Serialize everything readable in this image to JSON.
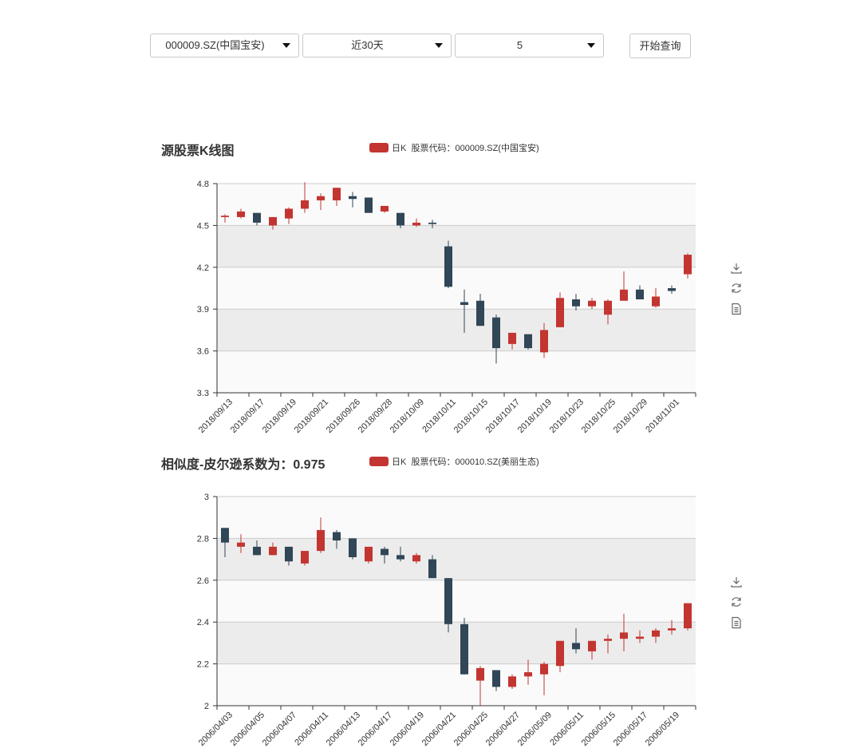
{
  "controls": {
    "stock_select": "000009.SZ(中国宝安)",
    "range_select": "近30天",
    "count_select": "5",
    "query_button": "开始查询"
  },
  "toolbox": [
    "download-icon",
    "refresh-icon",
    "data-view-icon"
  ],
  "colors": {
    "up": "#c23531",
    "down": "#314656",
    "band": "#ececec",
    "plot_bg": "#fafafa",
    "grid_line": "#cccccc"
  },
  "chart_data": [
    {
      "type": "candlestick",
      "title": "源股票K线图",
      "legend": "日K",
      "legend_note": "股票代码：000009.SZ(中国宝安)",
      "ylim": [
        3.3,
        4.8
      ],
      "yticks": [
        "4.8",
        "4.5",
        "4.2",
        "3.9",
        "3.6",
        "3.3"
      ],
      "ytick_values": [
        4.8,
        4.5,
        4.2,
        3.9,
        3.6,
        3.3
      ],
      "xtick_labels": [
        "2018/09/13",
        "2018/09/17",
        "2018/09/19",
        "2018/09/21",
        "2018/09/26",
        "2018/09/28",
        "2018/10/09",
        "2018/10/11",
        "2018/10/15",
        "2018/10/17",
        "2018/10/19",
        "2018/10/23",
        "2018/10/25",
        "2018/10/29",
        "2018/11/01"
      ],
      "candles": [
        {
          "o": 4.56,
          "c": 4.57,
          "l": 4.52,
          "h": 4.58
        },
        {
          "o": 4.56,
          "c": 4.6,
          "l": 4.55,
          "h": 4.62
        },
        {
          "o": 4.59,
          "c": 4.52,
          "l": 4.5,
          "h": 4.59
        },
        {
          "o": 4.5,
          "c": 4.56,
          "l": 4.47,
          "h": 4.56
        },
        {
          "o": 4.55,
          "c": 4.62,
          "l": 4.51,
          "h": 4.63
        },
        {
          "o": 4.62,
          "c": 4.68,
          "l": 4.59,
          "h": 4.81
        },
        {
          "o": 4.68,
          "c": 4.71,
          "l": 4.61,
          "h": 4.73
        },
        {
          "o": 4.68,
          "c": 4.77,
          "l": 4.64,
          "h": 4.77
        },
        {
          "o": 4.71,
          "c": 4.69,
          "l": 4.63,
          "h": 4.74
        },
        {
          "o": 4.7,
          "c": 4.59,
          "l": 4.59,
          "h": 4.7
        },
        {
          "o": 4.6,
          "c": 4.64,
          "l": 4.59,
          "h": 4.64
        },
        {
          "o": 4.59,
          "c": 4.5,
          "l": 4.48,
          "h": 4.59
        },
        {
          "o": 4.5,
          "c": 4.52,
          "l": 4.49,
          "h": 4.55
        },
        {
          "o": 4.52,
          "c": 4.51,
          "l": 4.48,
          "h": 4.54
        },
        {
          "o": 4.35,
          "c": 4.06,
          "l": 4.05,
          "h": 4.39
        },
        {
          "o": 3.95,
          "c": 3.93,
          "l": 3.73,
          "h": 4.04
        },
        {
          "o": 3.96,
          "c": 3.78,
          "l": 3.78,
          "h": 4.01
        },
        {
          "o": 3.84,
          "c": 3.62,
          "l": 3.51,
          "h": 3.86
        },
        {
          "o": 3.65,
          "c": 3.73,
          "l": 3.61,
          "h": 3.73
        },
        {
          "o": 3.72,
          "c": 3.62,
          "l": 3.61,
          "h": 3.72
        },
        {
          "o": 3.59,
          "c": 3.75,
          "l": 3.55,
          "h": 3.8
        },
        {
          "o": 3.77,
          "c": 3.98,
          "l": 3.77,
          "h": 4.02
        },
        {
          "o": 3.97,
          "c": 3.92,
          "l": 3.89,
          "h": 4.01
        },
        {
          "o": 3.92,
          "c": 3.96,
          "l": 3.9,
          "h": 3.98
        },
        {
          "o": 3.86,
          "c": 3.96,
          "l": 3.79,
          "h": 3.97
        },
        {
          "o": 3.96,
          "c": 4.04,
          "l": 3.96,
          "h": 4.17
        },
        {
          "o": 4.04,
          "c": 3.97,
          "l": 3.97,
          "h": 4.07
        },
        {
          "o": 3.92,
          "c": 3.99,
          "l": 3.91,
          "h": 4.05
        },
        {
          "o": 4.05,
          "c": 4.03,
          "l": 4.01,
          "h": 4.07
        },
        {
          "o": 4.15,
          "c": 4.29,
          "l": 4.12,
          "h": 4.3
        }
      ]
    },
    {
      "type": "candlestick",
      "title": "相似度-皮尔逊系数为：0.975",
      "legend": "日K",
      "legend_note": "股票代码：000010.SZ(美丽生态)",
      "ylim": [
        2,
        3
      ],
      "yticks": [
        "3",
        "2.8",
        "2.6",
        "2.4",
        "2.2",
        "2"
      ],
      "ytick_values": [
        3,
        2.8,
        2.6,
        2.4,
        2.2,
        2
      ],
      "xtick_labels": [
        "2006/04/03",
        "2006/04/05",
        "2006/04/07",
        "2006/04/11",
        "2006/04/13",
        "2006/04/17",
        "2006/04/19",
        "2006/04/21",
        "2006/04/25",
        "2006/04/27",
        "2006/05/09",
        "2006/05/11",
        "2006/05/15",
        "2006/05/17",
        "2006/05/19"
      ],
      "candles": [
        {
          "o": 2.85,
          "c": 2.78,
          "l": 2.71,
          "h": 2.85
        },
        {
          "o": 2.76,
          "c": 2.78,
          "l": 2.73,
          "h": 2.82
        },
        {
          "o": 2.76,
          "c": 2.72,
          "l": 2.72,
          "h": 2.79
        },
        {
          "o": 2.72,
          "c": 2.76,
          "l": 2.72,
          "h": 2.78
        },
        {
          "o": 2.76,
          "c": 2.69,
          "l": 2.67,
          "h": 2.76
        },
        {
          "o": 2.68,
          "c": 2.74,
          "l": 2.67,
          "h": 2.74
        },
        {
          "o": 2.74,
          "c": 2.84,
          "l": 2.73,
          "h": 2.9
        },
        {
          "o": 2.83,
          "c": 2.79,
          "l": 2.75,
          "h": 2.84
        },
        {
          "o": 2.8,
          "c": 2.71,
          "l": 2.7,
          "h": 2.8
        },
        {
          "o": 2.69,
          "c": 2.76,
          "l": 2.68,
          "h": 2.76
        },
        {
          "o": 2.75,
          "c": 2.72,
          "l": 2.68,
          "h": 2.76
        },
        {
          "o": 2.72,
          "c": 2.7,
          "l": 2.69,
          "h": 2.76
        },
        {
          "o": 2.69,
          "c": 2.72,
          "l": 2.68,
          "h": 2.73
        },
        {
          "o": 2.7,
          "c": 2.61,
          "l": 2.61,
          "h": 2.72
        },
        {
          "o": 2.61,
          "c": 2.39,
          "l": 2.35,
          "h": 2.61
        },
        {
          "o": 2.39,
          "c": 2.15,
          "l": 2.15,
          "h": 2.42
        },
        {
          "o": 2.12,
          "c": 2.18,
          "l": 2.0,
          "h": 2.19
        },
        {
          "o": 2.17,
          "c": 2.09,
          "l": 2.07,
          "h": 2.17
        },
        {
          "o": 2.09,
          "c": 2.14,
          "l": 2.08,
          "h": 2.15
        },
        {
          "o": 2.14,
          "c": 2.16,
          "l": 2.1,
          "h": 2.22
        },
        {
          "o": 2.15,
          "c": 2.2,
          "l": 2.05,
          "h": 2.21
        },
        {
          "o": 2.19,
          "c": 2.31,
          "l": 2.16,
          "h": 2.31
        },
        {
          "o": 2.3,
          "c": 2.27,
          "l": 2.25,
          "h": 2.37
        },
        {
          "o": 2.26,
          "c": 2.31,
          "l": 2.22,
          "h": 2.31
        },
        {
          "o": 2.31,
          "c": 2.32,
          "l": 2.25,
          "h": 2.34
        },
        {
          "o": 2.32,
          "c": 2.35,
          "l": 2.26,
          "h": 2.44
        },
        {
          "o": 2.32,
          "c": 2.33,
          "l": 2.3,
          "h": 2.36
        },
        {
          "o": 2.33,
          "c": 2.36,
          "l": 2.3,
          "h": 2.37
        },
        {
          "o": 2.36,
          "c": 2.37,
          "l": 2.34,
          "h": 2.41
        },
        {
          "o": 2.37,
          "c": 2.49,
          "l": 2.36,
          "h": 2.49
        }
      ]
    }
  ]
}
